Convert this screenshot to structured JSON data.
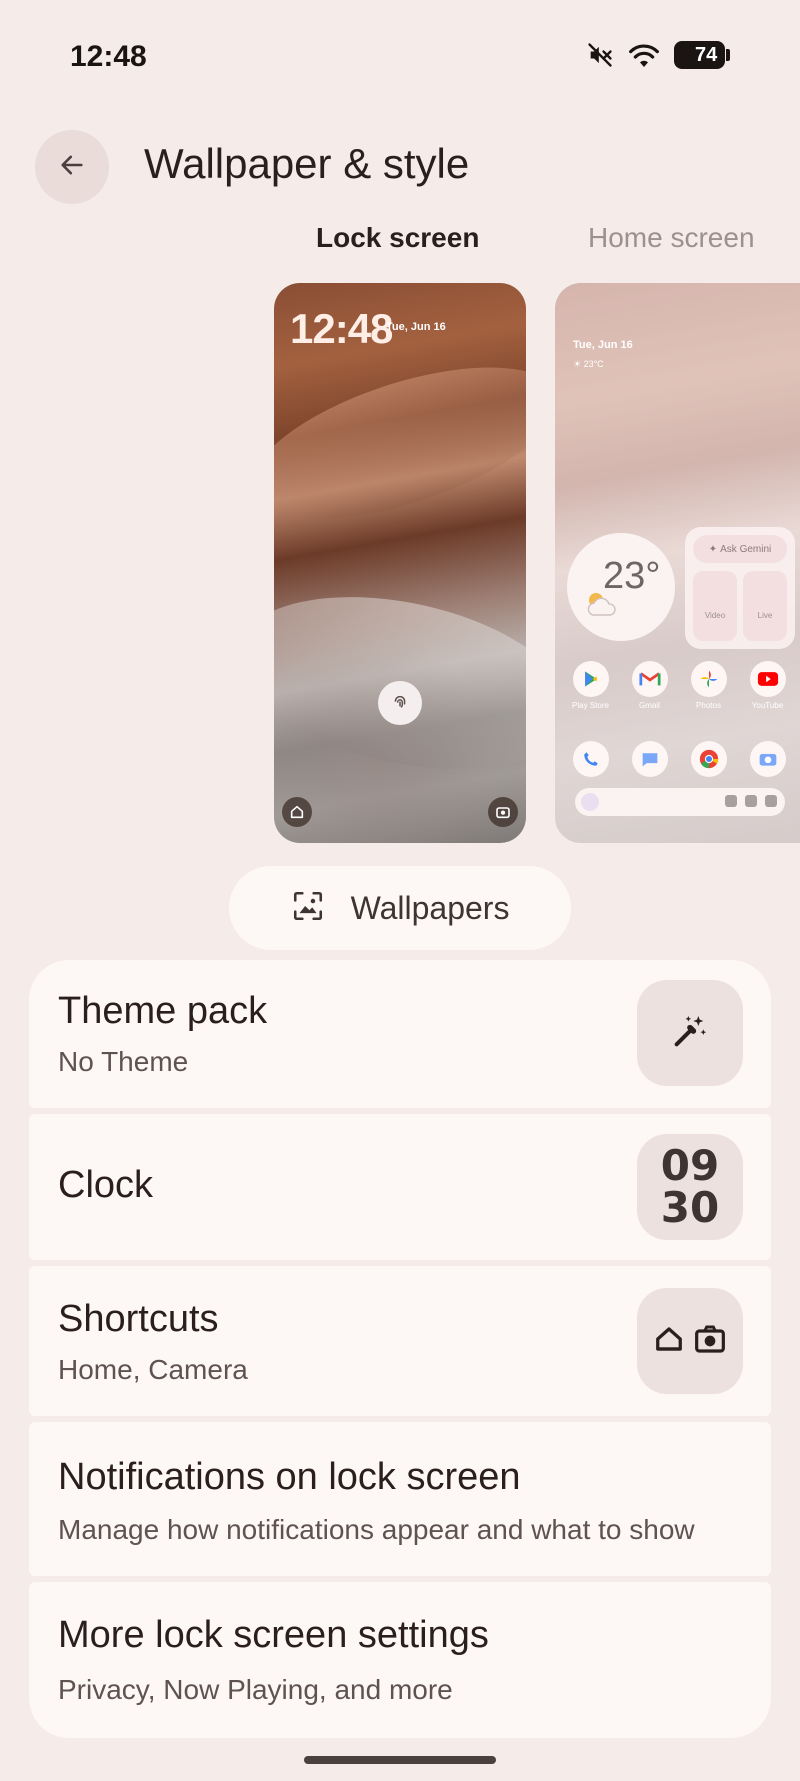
{
  "status_bar": {
    "time": "12:48",
    "battery_level": "74",
    "icons": [
      "mute-icon",
      "wifi-icon",
      "battery-icon"
    ]
  },
  "app_bar": {
    "title": "Wallpaper & style",
    "back_icon": "arrow-back-icon"
  },
  "tabs": [
    {
      "label": "Lock screen",
      "selected": true
    },
    {
      "label": "Home screen",
      "selected": false
    }
  ],
  "lock_preview": {
    "time": "12:48",
    "date": "Tue, Jun 16"
  },
  "home_preview": {
    "date": "Tue, Jun 16",
    "temp_small": "☀ 23°C",
    "weather_temp": "23°",
    "gemini_label": "Ask Gemini",
    "gemini_buttons": [
      "Video",
      "Live"
    ],
    "apps": [
      "Play Store",
      "Gmail",
      "Photos",
      "YouTube"
    ]
  },
  "wallpapers_button": {
    "label": "Wallpapers",
    "icon": "wallpaper-icon"
  },
  "settings": {
    "theme_pack": {
      "title": "Theme pack",
      "subtitle": "No Theme",
      "icon": "magic-wand-icon"
    },
    "clock": {
      "title": "Clock",
      "thumb_hours": "09",
      "thumb_minutes": "30"
    },
    "shortcuts": {
      "title": "Shortcuts",
      "subtitle": "Home, Camera"
    },
    "notifications": {
      "title": "Notifications on lock screen",
      "subtitle": "Manage how notifications appear and what to show"
    },
    "more": {
      "title": "More lock screen settings",
      "subtitle": "Privacy, Now Playing, and more"
    }
  },
  "colors": {
    "background": "#f5ebe9",
    "card": "#fdf7f6",
    "thumb": "#ece1de",
    "text_primary": "#2a1f1d",
    "text_secondary": "#5f5351",
    "tab_inactive": "#9d908d"
  }
}
